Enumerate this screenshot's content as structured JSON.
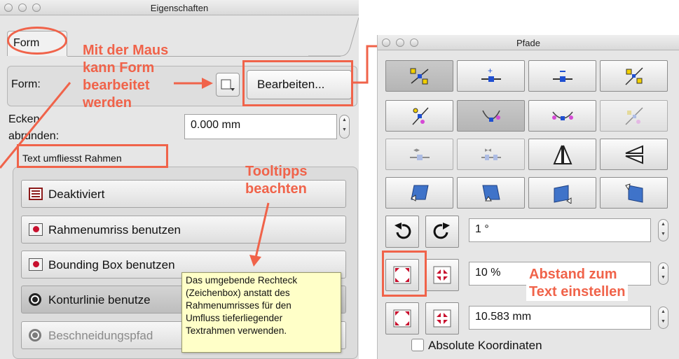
{
  "eigenschaften": {
    "title": "Eigenschaften",
    "tab_form": "Form",
    "form_label": "Form:",
    "edit_button": "Bearbeiten...",
    "corner_label_1": "Ecken",
    "corner_label_2": "abrunden:",
    "corner_value": "0.000 mm",
    "wrap_group_label": "Text umfliesst Rahmen",
    "options": [
      {
        "label": "Deaktiviert",
        "icon": "disabled-wrap-icon"
      },
      {
        "label": "Rahmenumriss benutzen",
        "icon": "frame-outline-icon"
      },
      {
        "label": "Bounding Box benutzen",
        "icon": "bounding-box-icon"
      },
      {
        "label": "Konturlinie benutze",
        "icon": "contour-line-icon"
      },
      {
        "label": "Beschneidungspfad",
        "icon": "clipping-path-icon"
      }
    ],
    "tooltip_lines": [
      "Das umgebende Rechteck",
      "(Zeichenbox) anstatt des",
      "Rahmenumrisses für den",
      "Umfluss tieferliegender",
      "Textrahmen verwenden."
    ]
  },
  "annotations": {
    "mouse_lines": [
      "Mit der Maus",
      "kann Form",
      "bearbeitet",
      "werden"
    ],
    "tooltips_lines": [
      "Tooltipps",
      "beachten"
    ],
    "distance_lines": [
      "Abstand zum",
      "Text einstellen"
    ],
    "color": "#f0634a"
  },
  "pfade": {
    "title": "Pfade",
    "rotate_value": "1 °",
    "scale_value": "10 %",
    "distance_value": "10.583 mm",
    "absolute_label": "Absolute Koordinaten"
  }
}
